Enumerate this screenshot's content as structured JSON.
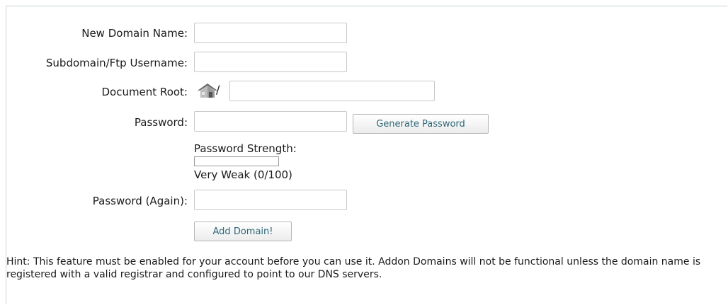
{
  "form": {
    "new_domain": {
      "label": "New Domain Name:",
      "value": "",
      "placeholder": ""
    },
    "subdomain": {
      "label": "Subdomain/Ftp Username:",
      "value": "",
      "placeholder": ""
    },
    "document_root": {
      "label": "Document Root:",
      "prefix": "/",
      "value": "",
      "icon": "house-icon"
    },
    "password": {
      "label": "Password:",
      "value": ""
    },
    "generate_button": "Generate Password",
    "strength": {
      "label": "Password Strength:",
      "fraction": 0,
      "text": "Very Weak (0/100)"
    },
    "password_again": {
      "label": "Password (Again):",
      "value": ""
    },
    "submit_button": "Add Domain!",
    "hint": "Hint: This feature must be enabled for your account before you can use it. Addon Domains will not be functional unless the domain name is registered with a valid registrar and configured to point to our DNS servers."
  },
  "colors": {
    "panel_border": "#c9d6c9",
    "button_text": "#2f6778",
    "strength_weak": "#d84a3c"
  }
}
